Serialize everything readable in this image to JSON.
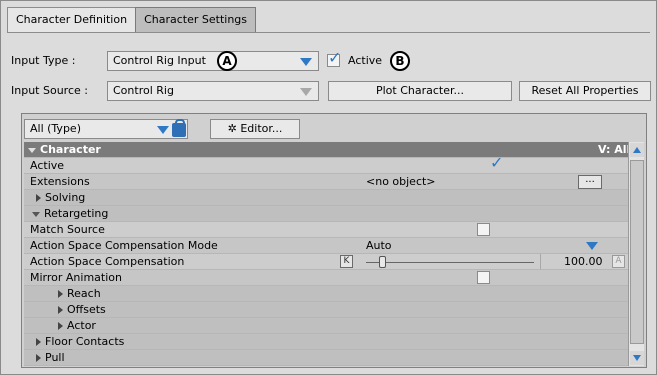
{
  "tabs": [
    {
      "label": "Character Definition"
    },
    {
      "label": "Character Settings"
    }
  ],
  "input_type": {
    "label": "Input Type :",
    "value": "Control Rig Input",
    "callout": "A"
  },
  "active_checkbox": {
    "label": "Active",
    "checked": true,
    "callout": "B"
  },
  "input_source": {
    "label": "Input Source :",
    "value": "Control Rig"
  },
  "buttons": {
    "plot": "Plot Character...",
    "reset": "Reset All Properties"
  },
  "filter": {
    "value": "All (Type)",
    "editor": "Editor..."
  },
  "grid": {
    "header": {
      "label": "Character",
      "right": "V: All"
    },
    "rows": [
      {
        "label": "Active",
        "value": "",
        "checked": true
      },
      {
        "label": "Extensions",
        "value": "<no object>"
      },
      {
        "label": "Solving"
      },
      {
        "label": "Retargeting"
      },
      {
        "label": "Match Source",
        "checked": false
      },
      {
        "label": "Action Space Compensation Mode",
        "value": "Auto"
      },
      {
        "label": "Action Space Compensation",
        "value": "100.00",
        "key": "K",
        "animate": "A"
      },
      {
        "label": "Mirror Animation",
        "checked": false
      },
      {
        "label": "Reach"
      },
      {
        "label": "Offsets"
      },
      {
        "label": "Actor"
      },
      {
        "label": "Floor Contacts"
      },
      {
        "label": "Pull"
      }
    ]
  },
  "colors": {
    "accent": "#2f78c4",
    "panel": "#dcdcdc"
  }
}
